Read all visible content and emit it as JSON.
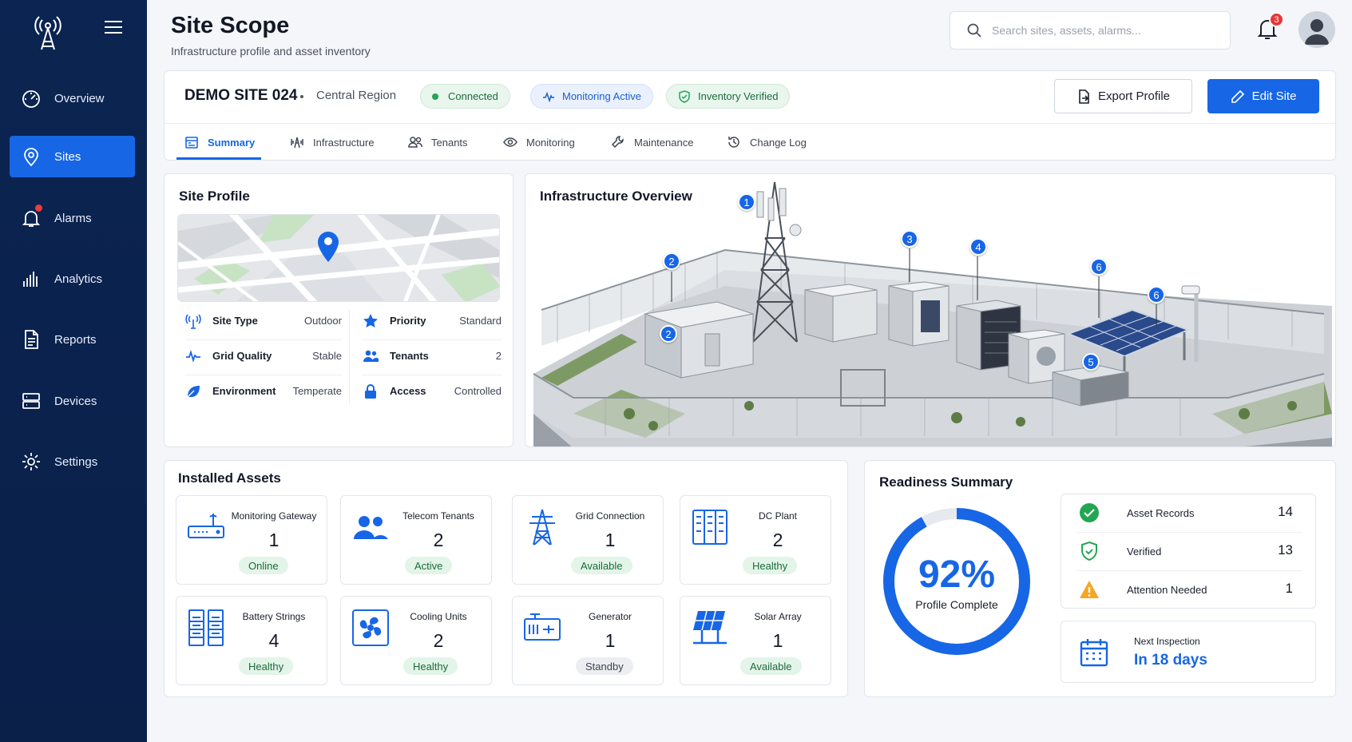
{
  "sidebar": {
    "items": [
      {
        "label": "Overview",
        "icon": "gauge-icon"
      },
      {
        "label": "Sites",
        "icon": "location-pin-icon",
        "active": true
      },
      {
        "label": "Alarms",
        "icon": "bell-icon",
        "has_dot": true
      },
      {
        "label": "Analytics",
        "icon": "bar-chart-icon"
      },
      {
        "label": "Reports",
        "icon": "document-icon"
      },
      {
        "label": "Devices",
        "icon": "server-icon"
      },
      {
        "label": "Settings",
        "icon": "gear-icon"
      }
    ]
  },
  "header": {
    "title": "Site Scope",
    "subtitle": "Infrastructure profile and asset inventory",
    "search_placeholder": "Search sites, assets, alarms...",
    "notification_count": "3"
  },
  "site": {
    "name": "DEMO SITE 024",
    "region": "Central Region",
    "badges": [
      {
        "label": "Connected",
        "style": "green"
      },
      {
        "label": "Monitoring Active",
        "style": "blue"
      },
      {
        "label": "Inventory Verified",
        "style": "green"
      }
    ],
    "export_label": "Export Profile",
    "edit_label": "Edit Site"
  },
  "tabs": [
    {
      "label": "Summary",
      "active": true
    },
    {
      "label": "Infrastructure"
    },
    {
      "label": "Tenants"
    },
    {
      "label": "Monitoring"
    },
    {
      "label": "Maintenance"
    },
    {
      "label": "Change Log"
    }
  ],
  "profile": {
    "title": "Site Profile",
    "left": [
      {
        "label": "Site Type",
        "value": "Outdoor",
        "icon": "antenna-icon"
      },
      {
        "label": "Grid Quality",
        "value": "Stable",
        "icon": "pulse-icon"
      },
      {
        "label": "Environment",
        "value": "Temperate",
        "icon": "leaf-icon"
      }
    ],
    "right": [
      {
        "label": "Priority",
        "value": "Standard",
        "icon": "star-icon"
      },
      {
        "label": "Tenants",
        "value": "2",
        "icon": "users-icon"
      },
      {
        "label": "Access",
        "value": "Controlled",
        "icon": "lock-icon"
      }
    ]
  },
  "overview": {
    "title": "Infrastructure Overview",
    "markers": [
      "1",
      "2",
      "2",
      "3",
      "4",
      "6",
      "6",
      "5"
    ]
  },
  "assets": {
    "title": "Installed Assets",
    "items": [
      {
        "name": "Monitoring Gateway",
        "count": "1",
        "status": "Online",
        "tone": "green",
        "icon": "router-icon"
      },
      {
        "name": "Telecom Tenants",
        "count": "2",
        "status": "Active",
        "tone": "green",
        "icon": "users-icon"
      },
      {
        "name": "Grid Connection",
        "count": "1",
        "status": "Available",
        "tone": "green",
        "icon": "pylon-icon"
      },
      {
        "name": "DC Plant",
        "count": "2",
        "status": "Healthy",
        "tone": "green",
        "icon": "rectifier-icon"
      },
      {
        "name": "Battery Strings",
        "count": "4",
        "status": "Healthy",
        "tone": "green",
        "icon": "battery-rack-icon"
      },
      {
        "name": "Cooling Units",
        "count": "2",
        "status": "Healthy",
        "tone": "green",
        "icon": "fan-icon"
      },
      {
        "name": "Generator",
        "count": "1",
        "status": "Standby",
        "tone": "grey",
        "icon": "generator-icon"
      },
      {
        "name": "Solar Array",
        "count": "1",
        "status": "Available",
        "tone": "green",
        "icon": "solar-panel-icon"
      }
    ]
  },
  "readiness": {
    "title": "Readiness Summary",
    "percent_label": "92%",
    "percent_value": 92,
    "caption": "Profile Complete",
    "rows": [
      {
        "label": "Asset Records",
        "value": "14",
        "icon": "check-circle-icon"
      },
      {
        "label": "Verified",
        "value": "13",
        "icon": "shield-check-icon"
      },
      {
        "label": "Attention Needed",
        "value": "1",
        "icon": "warning-icon"
      }
    ],
    "next_label": "Next Inspection",
    "next_value": "In 18 days"
  },
  "colors": {
    "accent": "#1766e6",
    "sidebar": "#0b2451",
    "ok": "#22a652",
    "warn": "#f5a623"
  }
}
